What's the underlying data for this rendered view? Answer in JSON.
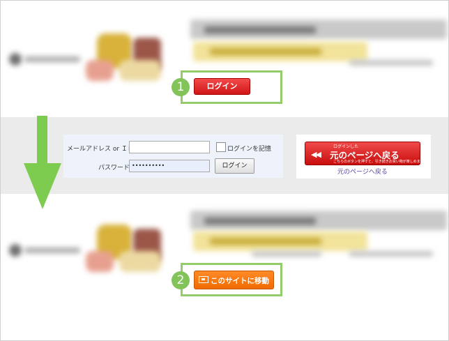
{
  "login_panel": {
    "email_label": "メールアドレス or ＩＤ",
    "password_label": "パスワード",
    "password_value": "••••••••••",
    "remember_label": "ログインを記憶",
    "login_button": "ログイン"
  },
  "return_panel": {
    "button_top_text": "ログインした",
    "button_main_text": "元のページへ戻る",
    "button_sub_text": "こちらのボタンを押すと、引き続きお買い物が楽しめます",
    "link_text": "元のページへ戻る"
  },
  "steps": [
    {
      "number": "1",
      "button_label": "ログイン"
    },
    {
      "number": "2",
      "button_label": "このサイトに移動"
    }
  ],
  "colors": {
    "highlight_green": "#93cc6b",
    "arrow_green": "#7dcc4f",
    "login_red": "#d01616",
    "move_orange": "#f06b00"
  }
}
